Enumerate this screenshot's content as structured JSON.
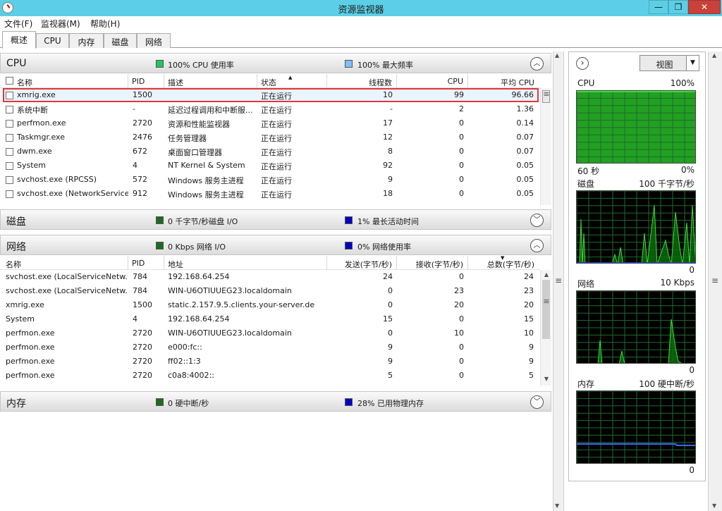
{
  "window": {
    "title": "资源监视器",
    "controls": {
      "minimize": "—",
      "maximize": "❐",
      "close": "✕"
    }
  },
  "menu": [
    "文件(F)",
    "监视器(M)",
    "帮助(H)"
  ],
  "tabs": [
    "概述",
    "CPU",
    "内存",
    "磁盘",
    "网络"
  ],
  "cpu_section": {
    "title": "CPU",
    "legend1": {
      "color": "#22c55e",
      "text": "100% CPU 使用率"
    },
    "legend2": {
      "color": "#7fbfff",
      "text": "100% 最大频率"
    },
    "columns": [
      "名称",
      "PID",
      "描述",
      "状态",
      "线程数",
      "CPU",
      "平均 CPU"
    ],
    "rows": [
      {
        "name": "xmrig.exe",
        "pid": "1500",
        "desc": "",
        "status": "正在运行",
        "threads": "10",
        "cpu": "99",
        "avg": "96.66"
      },
      {
        "name": "系统中断",
        "pid": "-",
        "desc": "延迟过程调用和中断服...",
        "status": "正在运行",
        "threads": "-",
        "cpu": "2",
        "avg": "1.36"
      },
      {
        "name": "perfmon.exe",
        "pid": "2720",
        "desc": "资源和性能监视器",
        "status": "正在运行",
        "threads": "17",
        "cpu": "0",
        "avg": "0.14"
      },
      {
        "name": "Taskmgr.exe",
        "pid": "2476",
        "desc": "任务管理器",
        "status": "正在运行",
        "threads": "12",
        "cpu": "0",
        "avg": "0.07"
      },
      {
        "name": "dwm.exe",
        "pid": "672",
        "desc": "桌面窗口管理器",
        "status": "正在运行",
        "threads": "8",
        "cpu": "0",
        "avg": "0.07"
      },
      {
        "name": "System",
        "pid": "4",
        "desc": "NT Kernel & System",
        "status": "正在运行",
        "threads": "92",
        "cpu": "0",
        "avg": "0.05"
      },
      {
        "name": "svchost.exe (RPCSS)",
        "pid": "572",
        "desc": "Windows 服务主进程",
        "status": "正在运行",
        "threads": "9",
        "cpu": "0",
        "avg": "0.05"
      },
      {
        "name": "svchost.exe (NetworkService)",
        "pid": "912",
        "desc": "Windows 服务主进程",
        "status": "正在运行",
        "threads": "18",
        "cpu": "0",
        "avg": "0.05"
      }
    ]
  },
  "disk_section": {
    "title": "磁盘",
    "legend1": {
      "color": "#1e6b1e",
      "text": "0 千字节/秒磁盘 I/O"
    },
    "legend2": {
      "color": "#0000c0",
      "text": "1% 最长活动时间"
    }
  },
  "network_section": {
    "title": "网络",
    "legend1": {
      "color": "#1e6b1e",
      "text": "0 Kbps 网络 I/O"
    },
    "legend2": {
      "color": "#0000c0",
      "text": "0% 网络使用率"
    },
    "columns": [
      "名称",
      "PID",
      "地址",
      "发送(字节/秒)",
      "接收(字节/秒)",
      "总数(字节/秒)"
    ],
    "rows": [
      {
        "name": "svchost.exe (LocalServiceNetw...",
        "pid": "784",
        "addr": "192.168.64.254",
        "send": "24",
        "recv": "0",
        "total": "24"
      },
      {
        "name": "svchost.exe (LocalServiceNetw...",
        "pid": "784",
        "addr": "WIN-U6OTIUUEG23.localdomain",
        "send": "0",
        "recv": "23",
        "total": "23"
      },
      {
        "name": "xmrig.exe",
        "pid": "1500",
        "addr": "static.2.157.9.5.clients.your-server.de",
        "send": "0",
        "recv": "20",
        "total": "20"
      },
      {
        "name": "System",
        "pid": "4",
        "addr": "192.168.64.254",
        "send": "15",
        "recv": "0",
        "total": "15"
      },
      {
        "name": "perfmon.exe",
        "pid": "2720",
        "addr": "WIN-U6OTIUUEG23.localdomain",
        "send": "0",
        "recv": "10",
        "total": "10"
      },
      {
        "name": "perfmon.exe",
        "pid": "2720",
        "addr": "e000:fc::",
        "send": "9",
        "recv": "0",
        "total": "9"
      },
      {
        "name": "perfmon.exe",
        "pid": "2720",
        "addr": "ff02::1:3",
        "send": "9",
        "recv": "0",
        "total": "9"
      },
      {
        "name": "perfmon.exe",
        "pid": "2720",
        "addr": "c0a8:4002::",
        "send": "5",
        "recv": "0",
        "total": "5"
      }
    ]
  },
  "memory_section": {
    "title": "内存",
    "legend1": {
      "color": "#1e6b1e",
      "text": "0 硬中断/秒"
    },
    "legend2": {
      "color": "#0000c0",
      "text": "28% 已用物理内存"
    }
  },
  "right_pane": {
    "view_label": "视图",
    "graphs": [
      {
        "title": "CPU",
        "max": "100%",
        "footer_left": "60 秒",
        "footer_right": "0%",
        "level": 1.0
      },
      {
        "title": "磁盘",
        "max": "100 千字节/秒",
        "footer_right": "0"
      },
      {
        "title": "网络",
        "max": "10 Kbps",
        "footer_right": "0"
      },
      {
        "title": "内存",
        "max": "100 硬中断/秒",
        "footer_right": "0",
        "level": 0.28
      }
    ]
  }
}
